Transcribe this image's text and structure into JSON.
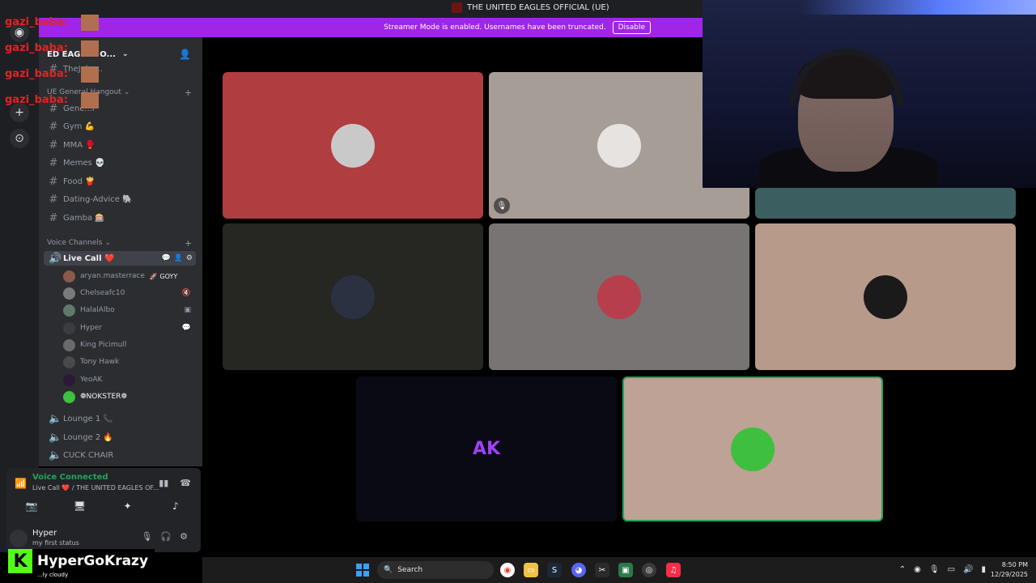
{
  "window": {
    "title": "THE UNITED EAGLES OFFICIAL (UE)"
  },
  "banner": {
    "message": "Streamer Mode is enabled. Usernames have been truncated.",
    "button": "Disable"
  },
  "overlay": {
    "name": "gazi_baba:"
  },
  "server": {
    "name": "ED EAGLES O...",
    "top_channel": "TheJoke..."
  },
  "categories": {
    "general": "UE General Hangout",
    "voice": "Voice Channels"
  },
  "text_channels": [
    {
      "label": "Gene...l"
    },
    {
      "label": "Gym 💪"
    },
    {
      "label": "MMA 🥊"
    },
    {
      "label": "Memes 💀"
    },
    {
      "label": "Food 🍟"
    },
    {
      "label": "Dating-Advice 🐘"
    },
    {
      "label": "Gamba 🎰"
    }
  ],
  "voice": {
    "active": "Live Call ❤️",
    "members": [
      {
        "name": "aryan.masterrace",
        "tag": "🚀 GOYY"
      },
      {
        "name": "Chelseafc10"
      },
      {
        "name": "HalalAlbo"
      },
      {
        "name": "Hyper"
      },
      {
        "name": "King Picimull"
      },
      {
        "name": "Tony Hawk"
      },
      {
        "name": "YeoAK"
      },
      {
        "name": "❁NOKSTER❁"
      }
    ],
    "other_channels": [
      {
        "label": "Lounge 1 📞"
      },
      {
        "label": "Lounge 2 🔥"
      },
      {
        "label": "CUCK CHAIR"
      }
    ]
  },
  "panel": {
    "status": "Voice Connected",
    "sub": "Live Call ❤️ / THE UNITED EAGLES OF..."
  },
  "user": {
    "name": "Hyper",
    "status": "my first status"
  },
  "logo": {
    "text": "HyperGoKrazy",
    "k": "K",
    "weather": "...ly cloudy"
  },
  "tiles": [
    {
      "bg": "#b03d3f",
      "av": "#c9c9c9"
    },
    {
      "bg": "#a79d97",
      "av": "#e6e3e0"
    },
    {
      "bg": "#3b5e60",
      "av": "#3b5e60"
    },
    {
      "bg": "#262622",
      "av": "#2a3140"
    },
    {
      "bg": "#777473",
      "av": "#b73f4b"
    },
    {
      "bg": "#b79a8a",
      "av": "#1a1a1a"
    },
    {
      "bg": "#0a0a14",
      "av": "#0a0a14",
      "text": "AK"
    },
    {
      "bg": "#bea296",
      "av": "#3fbf3f"
    }
  ],
  "taskbar": {
    "search": "Search",
    "time": "8:50 PM",
    "date": "12/29/2025"
  },
  "colors": {
    "accent": "#a025e6",
    "connected": "#23a55a",
    "overlay": "#e02424"
  }
}
